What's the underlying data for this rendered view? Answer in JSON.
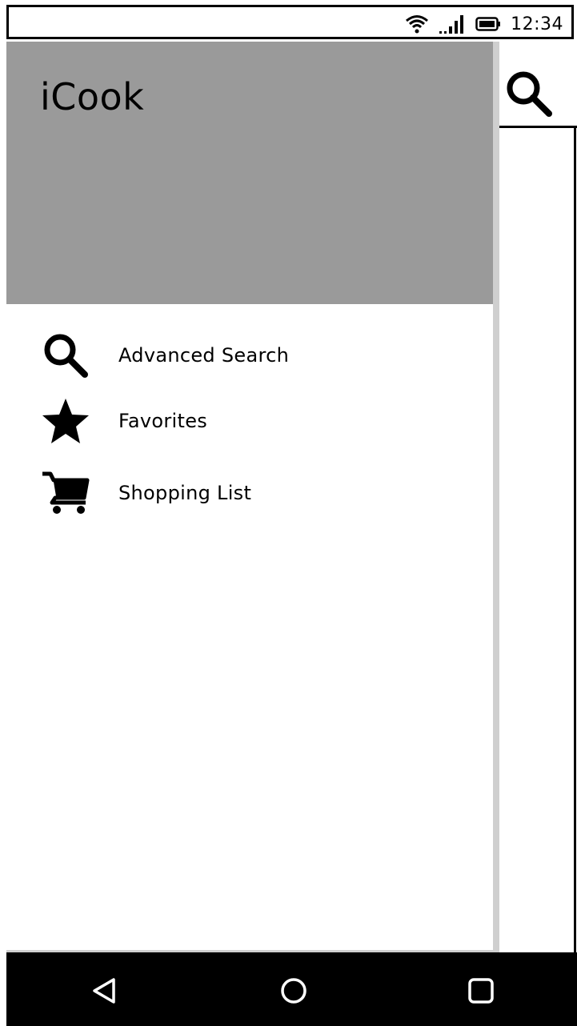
{
  "status_bar": {
    "time": "12:34",
    "icons": [
      "wifi-icon",
      "signal-icon",
      "battery-icon"
    ]
  },
  "drawer": {
    "app_title": "iCook",
    "header_color": "#9a9a9a",
    "items": [
      {
        "label": "Advanced Search",
        "icon": "search-icon"
      },
      {
        "label": "Favorites",
        "icon": "star-icon"
      },
      {
        "label": "Shopping List",
        "icon": "cart-icon"
      }
    ]
  },
  "app": {
    "toolbar_icon": "search-icon"
  },
  "nav_bar": {
    "buttons": [
      "back-icon",
      "home-icon",
      "recents-icon"
    ]
  }
}
